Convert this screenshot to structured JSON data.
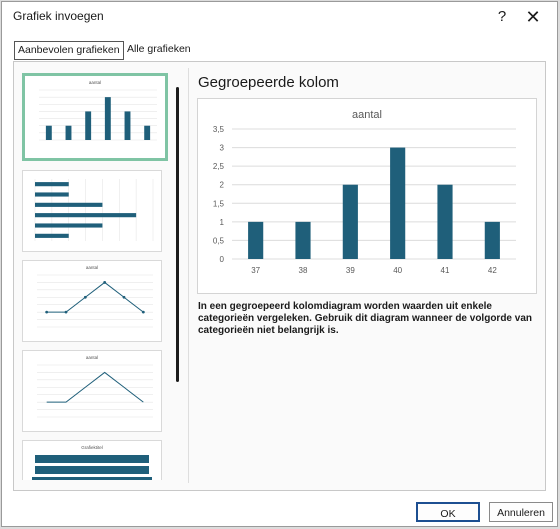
{
  "window": {
    "title": "Grafiek invoegen",
    "help_glyph": "?",
    "close_glyph": "✕"
  },
  "tabs": [
    {
      "label": "Aanbevolen grafieken",
      "selected": true
    },
    {
      "label": "Alle grafieken",
      "selected": false
    }
  ],
  "preview": {
    "heading": "Gegroepeerde kolom",
    "description": "In een gegroepeerd kolomdiagram worden waarden uit enkele categorieën vergeleken. Gebruik dit diagram wanneer de volgorde van categorieën niet belangrijk is."
  },
  "buttons": {
    "ok": "OK",
    "cancel": "Annuleren"
  },
  "colors": {
    "series": "#1f5f7a",
    "selection": "#7fc4a4",
    "grid": "#dcdcdc",
    "axis_text": "#595959"
  },
  "chart_data": {
    "type": "bar",
    "title": "aantal",
    "categories": [
      "37",
      "38",
      "39",
      "40",
      "41",
      "42"
    ],
    "values": [
      1,
      1,
      2,
      3,
      2,
      1
    ],
    "yticks": [
      "0",
      "0,5",
      "1",
      "1,5",
      "2",
      "2,5",
      "3",
      "3,5"
    ],
    "ylim": [
      0,
      3.5
    ],
    "grid": true,
    "legend": "none"
  },
  "thumbnails": [
    {
      "kind": "column",
      "title": "aantal",
      "selected": true
    },
    {
      "kind": "bar",
      "title": "",
      "selected": false
    },
    {
      "kind": "line-markers",
      "title": "aantal",
      "selected": false
    },
    {
      "kind": "line",
      "title": "aantal",
      "selected": false
    },
    {
      "kind": "funnel",
      "title": "Grafiektitel",
      "selected": false
    }
  ]
}
